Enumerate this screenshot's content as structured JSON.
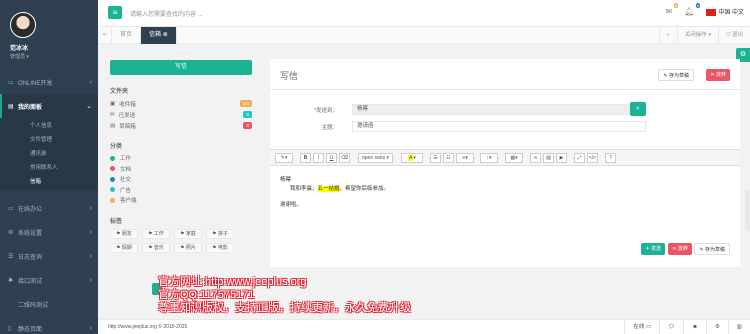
{
  "profile": {
    "name": "范冰冰",
    "role": "管理员"
  },
  "menu": {
    "online_dev": "ONLINE开发",
    "my_panel": "我的面板",
    "online_office": "在线办公",
    "sys_settings": "系统设置",
    "log_query": "日志查询",
    "interface_test": "接口测试",
    "qrcode_test": "二维码测试",
    "static_pages": "静态页面",
    "sub": [
      "个人信息",
      "文件管理",
      "通讯录",
      "常用联系人",
      "信箱"
    ]
  },
  "topbar": {
    "search_placeholder": "请输入您需要查找的内容 ...",
    "badge1": "0",
    "badge2": "0",
    "lang": "中国 中文"
  },
  "tabs": {
    "home": "首页",
    "mailbox": "信箱",
    "close_ops": "关闭操作",
    "logout": "退出"
  },
  "left": {
    "write_btn": "写信",
    "folders_title": "文件夹",
    "folders": [
      {
        "label": "收件箱",
        "count": "0/0",
        "color": "#f8ac59"
      },
      {
        "label": "已发送",
        "count": "0",
        "color": "#23c6c8"
      },
      {
        "label": "草稿箱",
        "count": "0",
        "color": "#ed5565"
      }
    ],
    "cat_title": "分类",
    "cats": [
      {
        "label": "工作",
        "color": "#1ab394"
      },
      {
        "label": "文档",
        "color": "#ed5565"
      },
      {
        "label": "社交",
        "color": "#1c84c6"
      },
      {
        "label": "广告",
        "color": "#23c6c8"
      },
      {
        "label": "客户端",
        "color": "#f8ac59"
      }
    ],
    "tags_title": "标签",
    "tags": [
      "朋友",
      "工作",
      "家庭",
      "孩子",
      "假期",
      "音乐",
      "照片",
      "电影"
    ]
  },
  "compose": {
    "title": "写信",
    "save_draft": "存为草稿",
    "discard": "放弃",
    "to_label": "*发送到：",
    "to_value": "杨幂",
    "subject_label": "主题：",
    "subject_value": "邀请函",
    "font_name": "open sans",
    "body_line1": "杨幂",
    "body_line2a": "我和李晨，",
    "body_line2hl": "五一结婚",
    "body_line2b": "，希望你后临参加。",
    "body_line3": "谢谢啦。",
    "send": "发送",
    "discard2": "放弃",
    "save_draft2": "存为草稿"
  },
  "footer": {
    "copyright": "http://www.jeeplus.org © 2015-2025",
    "online": "在线"
  },
  "watermark": {
    "line1": "官方网址:http:www.jeeplus.org",
    "line2": "官方QQ:117575171",
    "line3": "尊重知识版权，支持正版，持续更新，永久免费升级"
  }
}
